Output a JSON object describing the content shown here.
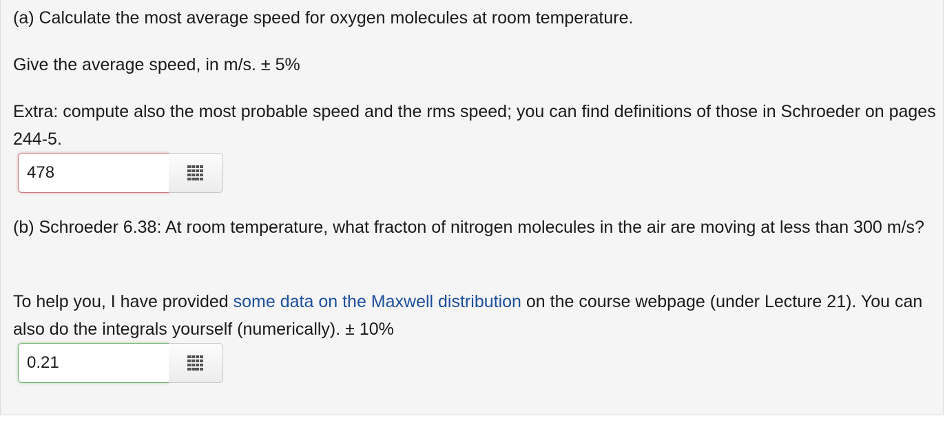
{
  "part_a": {
    "question": "(a) Calculate the most average speed for oxygen molecules at room temperature.",
    "instruction": "Give the average speed, in m/s. ± 5%",
    "extra": "Extra: compute also the most probable speed and the rms speed; you can find definitions of those in Schroeder on pages 244-5.",
    "answer_value": "478",
    "answer_status": "incorrect",
    "keyboard_icon": "keypad-icon"
  },
  "part_b": {
    "question": "(b) Schroeder 6.38: At room temperature, what fracton of nitrogen molecules in the air are moving at less than 300 m/s?",
    "help_prefix": "To help you, I have provided ",
    "help_link": "some data on the Maxwell distribution",
    "help_suffix": " on the course webpage (under Lecture 21). You can also do the integrals yourself (numerically). ± 10%",
    "answer_value": "0.21",
    "answer_status": "correct",
    "keyboard_icon": "keypad-icon"
  },
  "colors": {
    "panel_background": "#f5f5f5",
    "link": "#1c4f9c",
    "incorrect_border": "#c9797d",
    "correct_border": "#6fae6a"
  }
}
